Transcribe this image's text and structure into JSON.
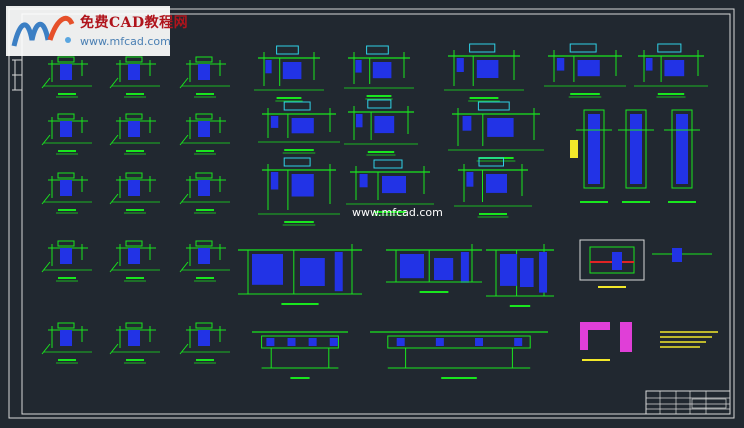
{
  "logo": {
    "title": "免费CAD教程网",
    "url": "www.mfcad.com"
  },
  "watermark": "www.mfcad.com",
  "colors": {
    "background": "#212830",
    "geometry": "#19e61e",
    "rebar": "#2233e6",
    "frame": "#d8d8d8",
    "callout": "#f2e82a",
    "bar_red": "#e02424",
    "magenta": "#e03fd7",
    "cyan": "#2fd1e6"
  }
}
